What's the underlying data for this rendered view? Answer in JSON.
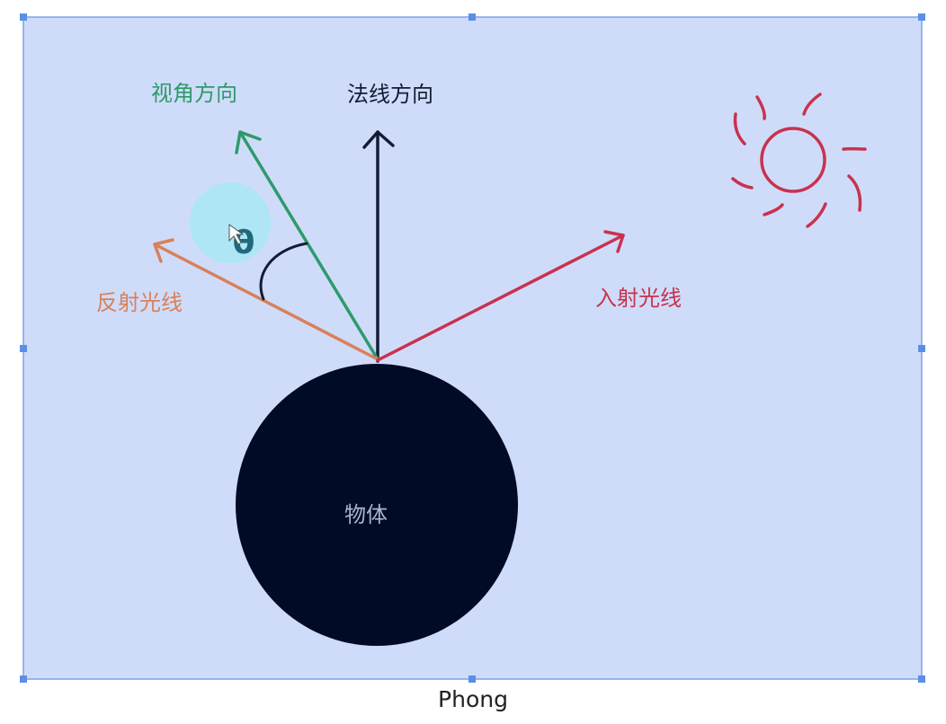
{
  "diagram": {
    "labels": {
      "view_direction": "视角方向",
      "normal_direction": "法线方向",
      "reflected_ray": "反射光线",
      "incident_ray": "入射光线",
      "object": "物体",
      "angle_symbol": "θ"
    },
    "caption": "Phong",
    "colors": {
      "canvas_fill": "#cfdcf9",
      "selection_border": "#7fa2e6",
      "handle": "#5b8fe6",
      "view_vector": "#2e9a6b",
      "normal_vector": "#151b33",
      "reflected_vector": "#d9805a",
      "incident_vector": "#c8324f",
      "sun": "#c8324f",
      "object_fill": "#020b26",
      "object_label": "#aab4cc",
      "cursor_highlight": "#a8e8f6",
      "angle_symbol": "#1f6a7a"
    },
    "icons": [
      "sun-icon",
      "cursor-highlight-icon"
    ]
  }
}
